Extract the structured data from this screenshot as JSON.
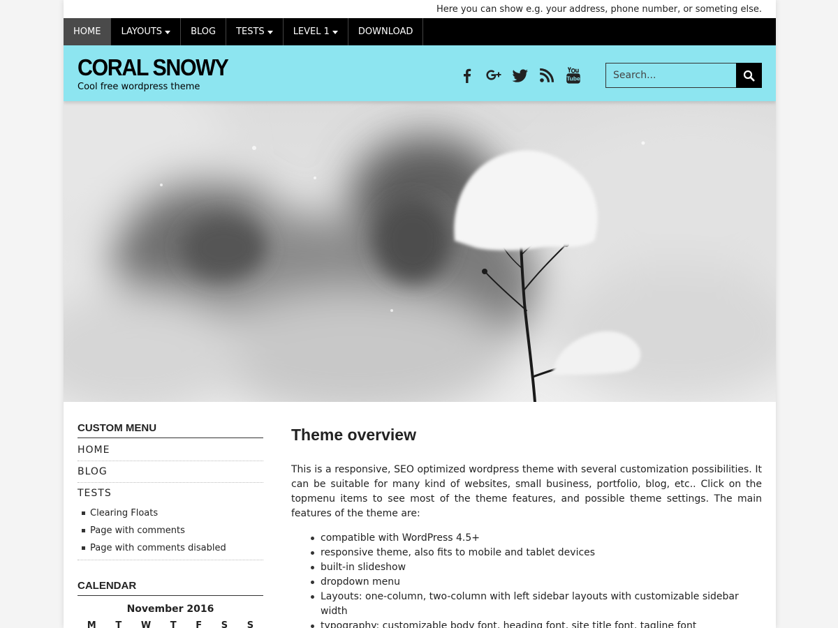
{
  "top_info": "Here you can show e.g. your address, phone number, or someting else.",
  "nav": {
    "items": [
      {
        "label": "HOME"
      },
      {
        "label": "LAYOUTS"
      },
      {
        "label": "BLOG"
      },
      {
        "label": "TESTS"
      },
      {
        "label": "LEVEL 1"
      },
      {
        "label": "DOWNLOAD"
      }
    ]
  },
  "header": {
    "title": "CORAL SNOWY",
    "tagline": "Cool free wordpress theme",
    "bg_color": "#8de5f0",
    "socials": [
      "facebook-icon",
      "google-plus-icon",
      "twitter-icon",
      "rss-icon",
      "youtube-icon"
    ]
  },
  "search": {
    "placeholder": "Search..."
  },
  "sidebar": {
    "custom_menu_title": "CUSTOM MENU",
    "menu": [
      {
        "label": "HOME"
      },
      {
        "label": "BLOG"
      },
      {
        "label": "TESTS"
      }
    ],
    "submenu": [
      {
        "label": "Clearing Floats"
      },
      {
        "label": "Page with comments"
      },
      {
        "label": "Page with comments disabled"
      }
    ],
    "calendar_title": "CALENDAR",
    "calendar_caption": "November 2016",
    "calendar_days": [
      "M",
      "T",
      "W",
      "T",
      "F",
      "S",
      "S"
    ]
  },
  "content": {
    "title": "Theme overview",
    "intro": "This is a responsive, SEO optimized wordpress theme with several customization possibilities. It can be suitable for many kind of websites, small business, portfolio, blog, etc.. Click on the topmenu items to see most of the theme features, and possible theme settings. The main features of the theme are:",
    "features": [
      "compatible with WordPress 4.5+",
      "responsive theme, also fits to mobile and tablet devices",
      "built-in slideshow",
      "dropdown menu",
      "Layouts: one-column, two-column with left sidebar layouts with customizable sidebar width",
      "typography: customizable body font, heading font, site title font, tagline font"
    ]
  }
}
